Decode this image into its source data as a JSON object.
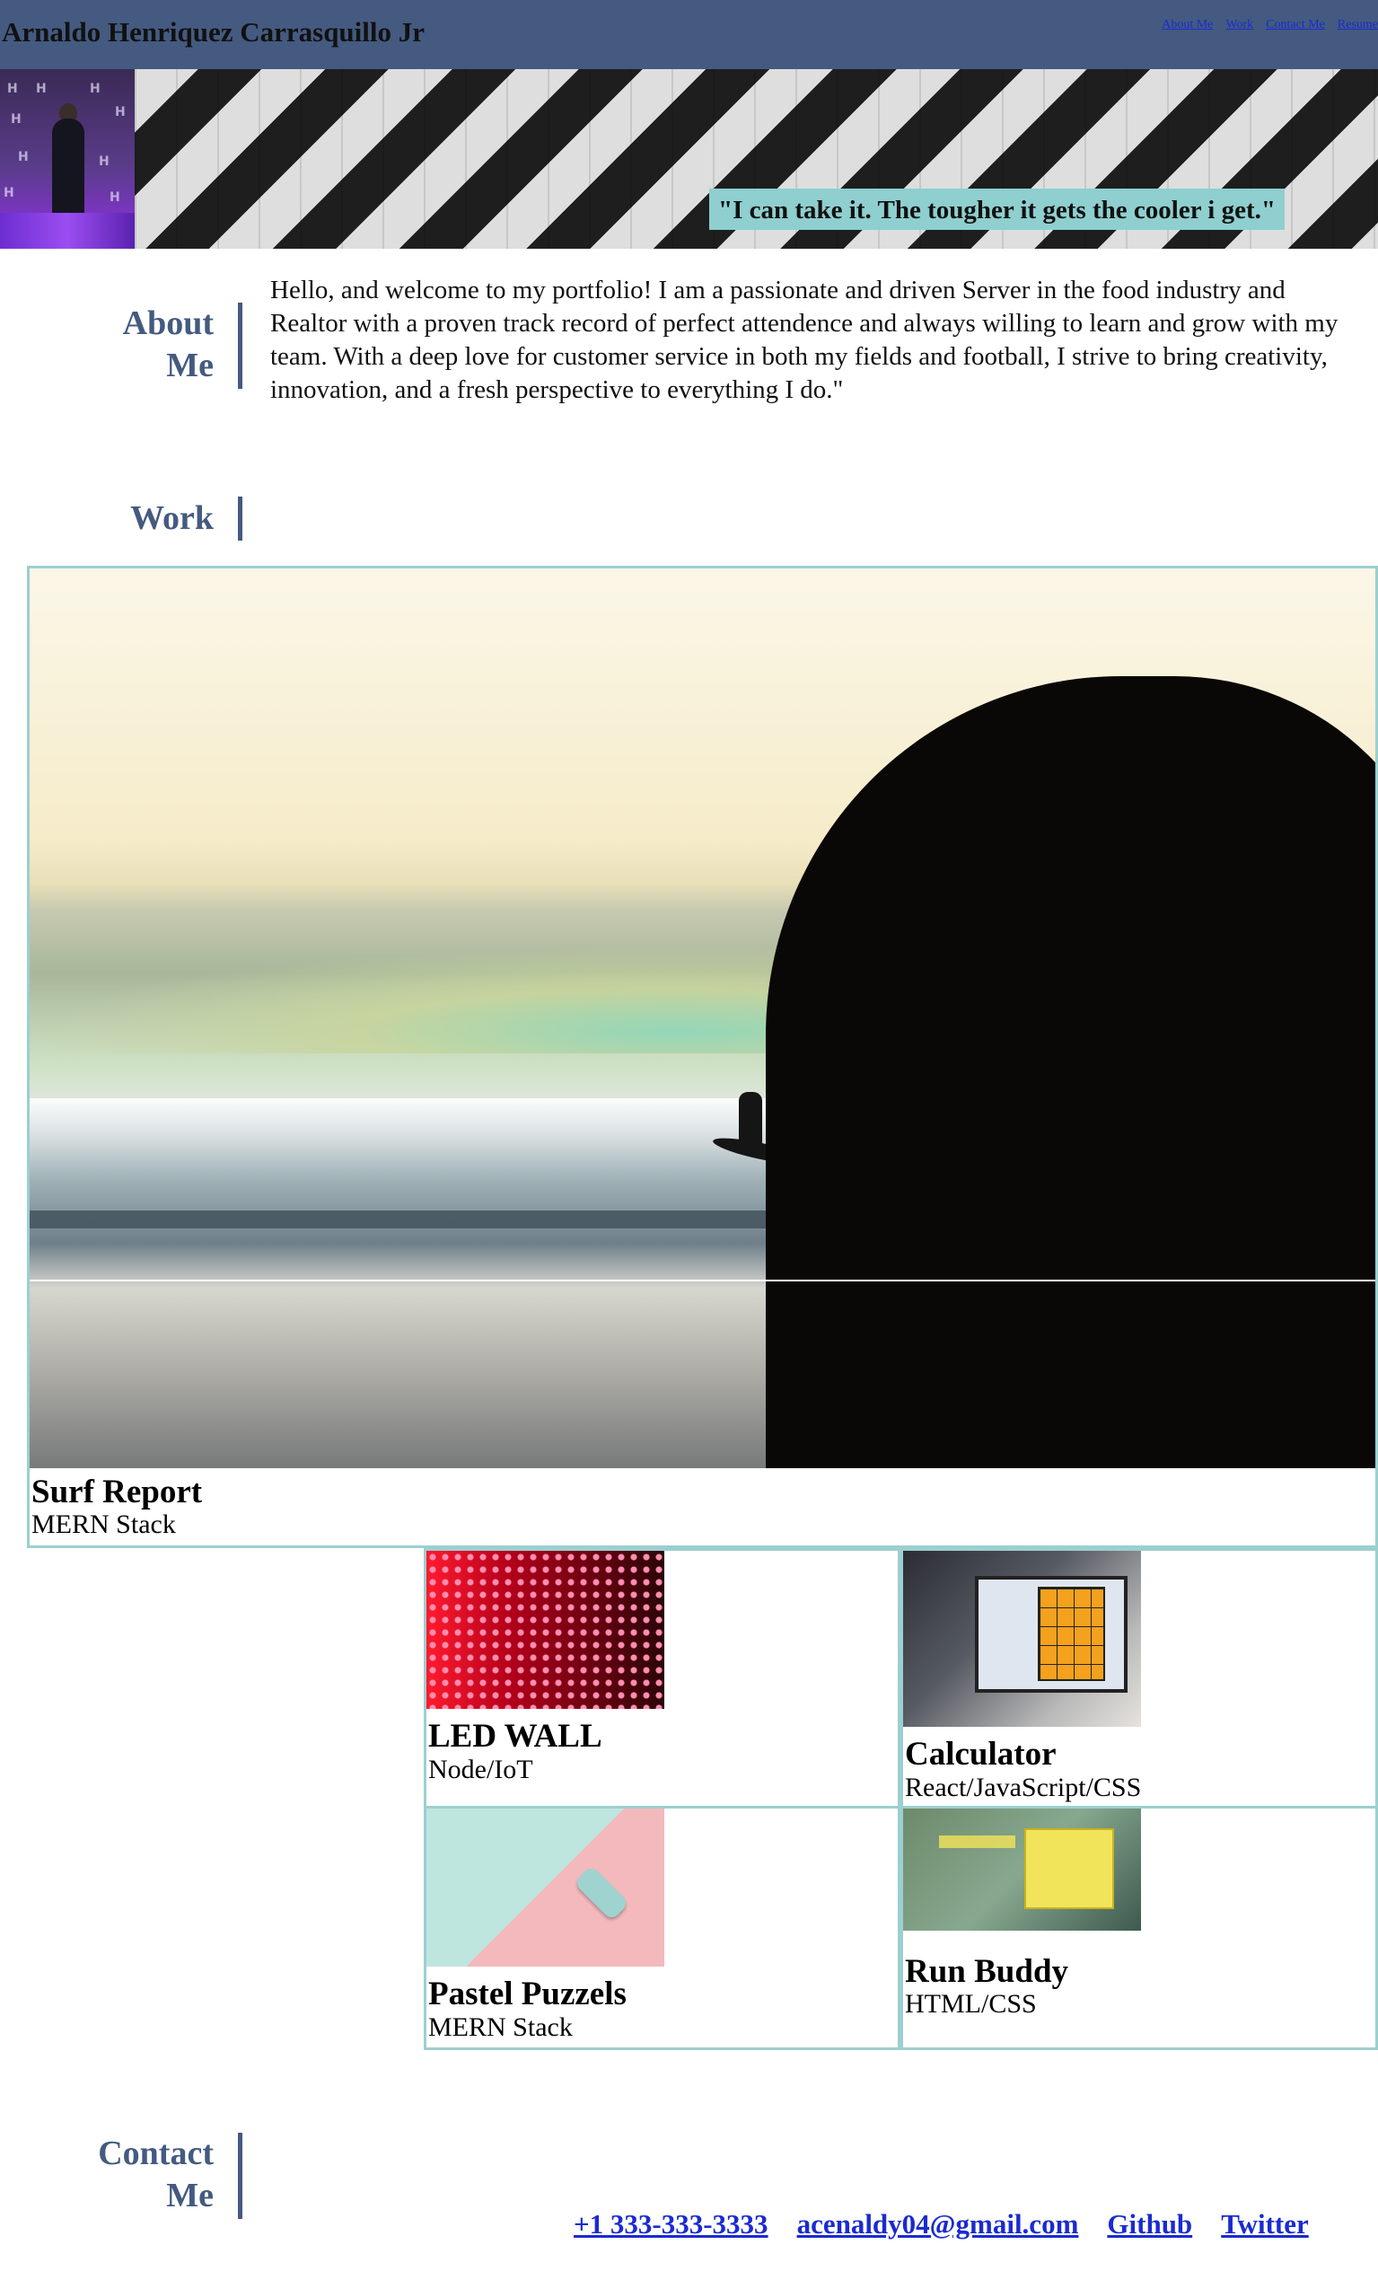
{
  "header": {
    "title": "Arnaldo Henriquez Carrasquillo Jr",
    "nav": [
      "About Me",
      "Work",
      "Contact Me",
      "Resume"
    ],
    "bg_color": "#445a80"
  },
  "hero": {
    "quote": "\"I can take it. The tougher it gets the cooler i get.\"",
    "accent": "#8fcfcf"
  },
  "about": {
    "heading_line1": "About",
    "heading_line2": "Me",
    "text": "Hello, and welcome to my portfolio! I am a passionate and driven Server in the food industry and Realtor with a proven track record of perfect attendence and always willing to learn and grow with my team. With a deep love for customer service in both my fields and football, I strive to bring creativity, innovation, and a fresh perspective to everything I do.\""
  },
  "work": {
    "heading": "Work",
    "featured": {
      "title": "Surf Report",
      "tech": "MERN Stack"
    },
    "projects": [
      {
        "title": "LED WALL",
        "tech": "Node/IoT"
      },
      {
        "title": "Calculator",
        "tech": "React/JavaScript/CSS"
      },
      {
        "title": "Pastel Puzzels",
        "tech": "MERN Stack"
      },
      {
        "title": "Run Buddy",
        "tech": "HTML/CSS"
      }
    ]
  },
  "contact": {
    "heading_line1": "Contact",
    "heading_line2": "Me",
    "links": [
      "+1 333-333-3333",
      "acenaldy04@gmail.com",
      "Github",
      "Twitter"
    ]
  }
}
